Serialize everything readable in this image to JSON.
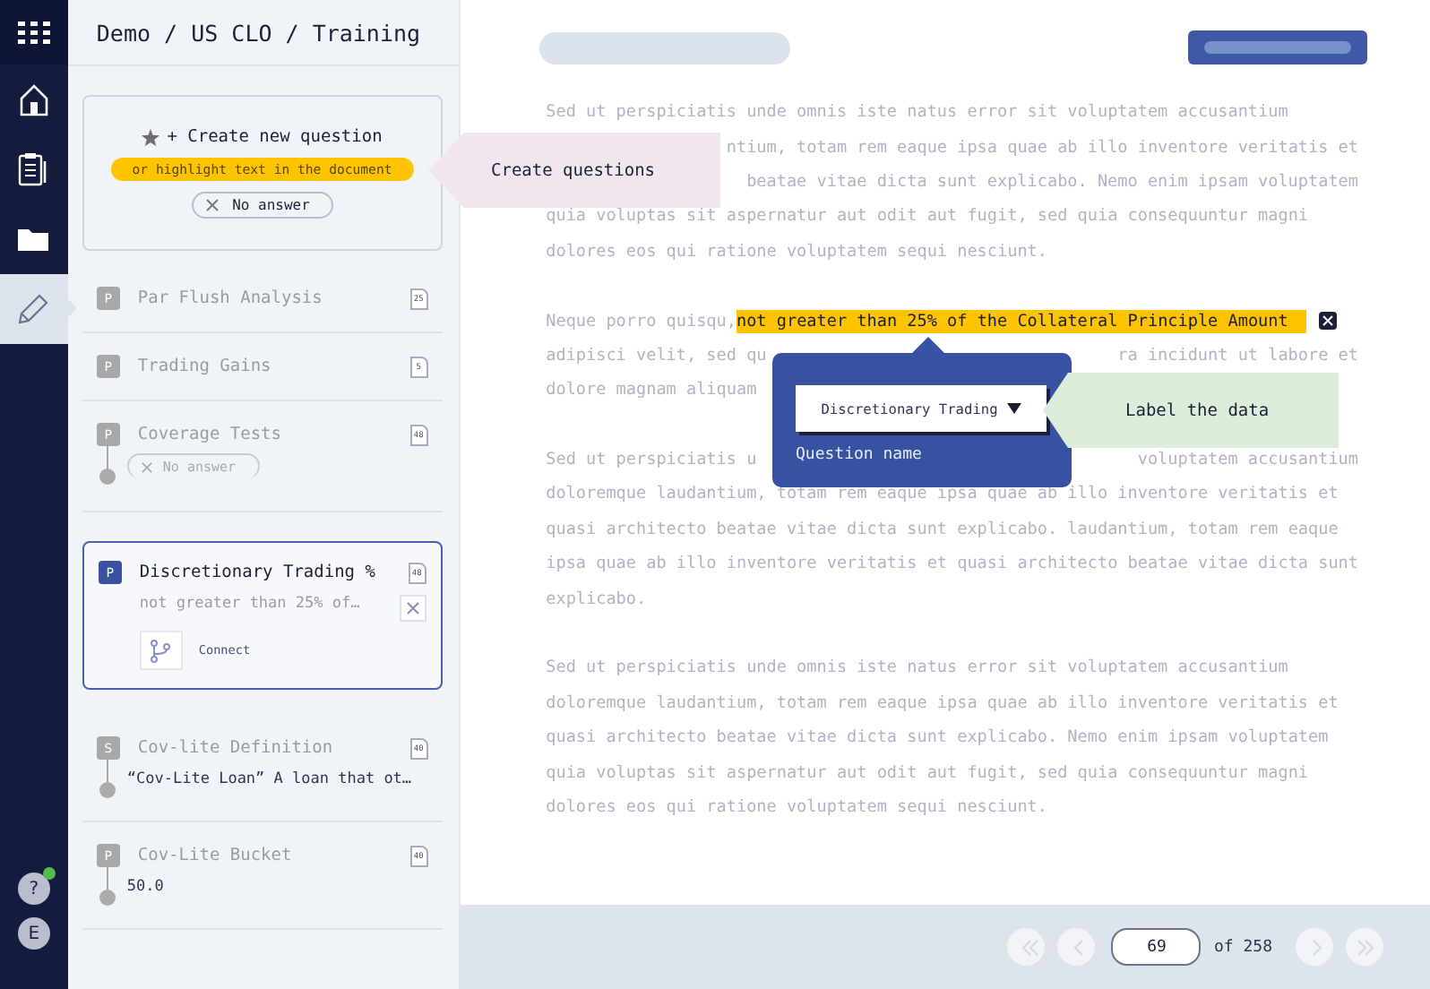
{
  "nav": {
    "items": [
      {
        "kind": "home",
        "selected": false
      },
      {
        "kind": "clipboard",
        "selected": false
      },
      {
        "kind": "folder",
        "selected": false
      },
      {
        "kind": "pencil",
        "selected": true
      }
    ],
    "help": {
      "label": "?",
      "notification": true
    },
    "avatar": "E"
  },
  "breadcrumb": "Demo / US CLO / Training",
  "create_card": {
    "title": "+ Create new question",
    "hint": "or highlight text in the document",
    "answer_chip": "No answer"
  },
  "questions": [
    {
      "badge": "P",
      "title": "Par Flush Analysis",
      "page": "25",
      "selected": false
    },
    {
      "badge": "P",
      "title": "Trading Gains",
      "page": "5",
      "selected": false
    },
    {
      "badge": "P",
      "title": "Coverage Tests",
      "page": "48",
      "selected": false,
      "kind": "none",
      "answer": "No answer"
    },
    {
      "badge": "P",
      "title": "Discretionary Trading %",
      "page": "48",
      "selected": true,
      "kind": "text",
      "answer": "not greater than 25% of…",
      "action": "Connect"
    },
    {
      "badge": "S",
      "title": "Cov-lite Definition",
      "page": "40",
      "selected": false,
      "kind": "text",
      "answer": "“Cov-Lite Loan” A loan that ot…"
    },
    {
      "badge": "P",
      "title": "Cov-Lite Bucket",
      "page": "40",
      "selected": false,
      "kind": "text",
      "answer": "50.0"
    }
  ],
  "document": {
    "paragraphs": [
      {
        "lines": [
          {
            "kind": "full",
            "segments": [
              "Sed ut perspiciatis unde omnis iste natus error sit voluptatem accusantium"
            ]
          },
          {
            "kind": "tail",
            "segments": [
              "ntium, totam rem eaque ipsa quae ab illo inventore veritatis et"
            ]
          },
          {
            "kind": "tail",
            "segments": [
              "beatae vitae dicta sunt explicabo. Nemo enim ipsam voluptatem"
            ]
          },
          {
            "kind": "full",
            "segments": [
              "quia voluptas sit aspernatur aut odit aut fugit, sed quia consequuntur magni"
            ]
          },
          {
            "kind": "full",
            "segments": [
              "dolores eos qui ratione voluptatem sequi nesciunt."
            ]
          }
        ]
      },
      {
        "lines": [
          {
            "kind": "highlight",
            "segments": [
              "Neque porro quisqu,"
            ],
            "highlight": "not greater than 25% of the Collateral Principle Amount"
          },
          {
            "kind": "split",
            "segments": [
              "adipisci velit, sed qu",
              "ra incidunt ut labore et"
            ]
          },
          {
            "kind": "head",
            "segments": [
              "dolore magnam aliquam"
            ]
          }
        ]
      },
      {
        "lines": [
          {
            "kind": "split",
            "segments": [
              "Sed ut perspiciatis u",
              "voluptatem accusantium"
            ]
          },
          {
            "kind": "full",
            "segments": [
              "doloremque laudantium, totam rem eaque ipsa quae ab illo inventore veritatis et"
            ]
          },
          {
            "kind": "full",
            "segments": [
              "quasi architecto beatae vitae dicta sunt explicabo. laudantium, totam rem eaque"
            ]
          },
          {
            "kind": "full",
            "segments": [
              "ipsa quae ab illo inventore veritatis et quasi architecto beatae vitae dicta sunt"
            ]
          },
          {
            "kind": "full",
            "segments": [
              "explicabo."
            ]
          }
        ]
      },
      {
        "lines": [
          {
            "kind": "full",
            "segments": [
              "Sed ut perspiciatis unde omnis iste natus error sit voluptatem accusantium"
            ]
          },
          {
            "kind": "full",
            "segments": [
              "doloremque laudantium, totam rem eaque ipsa quae ab illo inventore veritatis et"
            ]
          },
          {
            "kind": "full",
            "segments": [
              "quasi architecto beatae vitae dicta sunt explicabo. Nemo enim ipsam voluptatem"
            ]
          },
          {
            "kind": "full",
            "segments": [
              "quia voluptas sit aspernatur aut odit aut fugit, sed quia consequuntur magni"
            ]
          },
          {
            "kind": "full",
            "segments": [
              "dolores eos qui ratione voluptatem sequi nesciunt."
            ]
          }
        ]
      }
    ]
  },
  "label_popup": {
    "question": "Discretionary Trading",
    "caption": "Question name"
  },
  "tips": [
    {
      "kind": "create",
      "text": "Create questions"
    },
    {
      "kind": "label",
      "text": "Label the data"
    }
  ],
  "pagination": {
    "page": "69",
    "total": "of 258",
    "buttons": [
      {
        "kind": "first",
        "disabled": true
      },
      {
        "kind": "prev",
        "disabled": true
      },
      {
        "kind": "next",
        "disabled": true
      },
      {
        "kind": "last",
        "disabled": true
      }
    ]
  }
}
